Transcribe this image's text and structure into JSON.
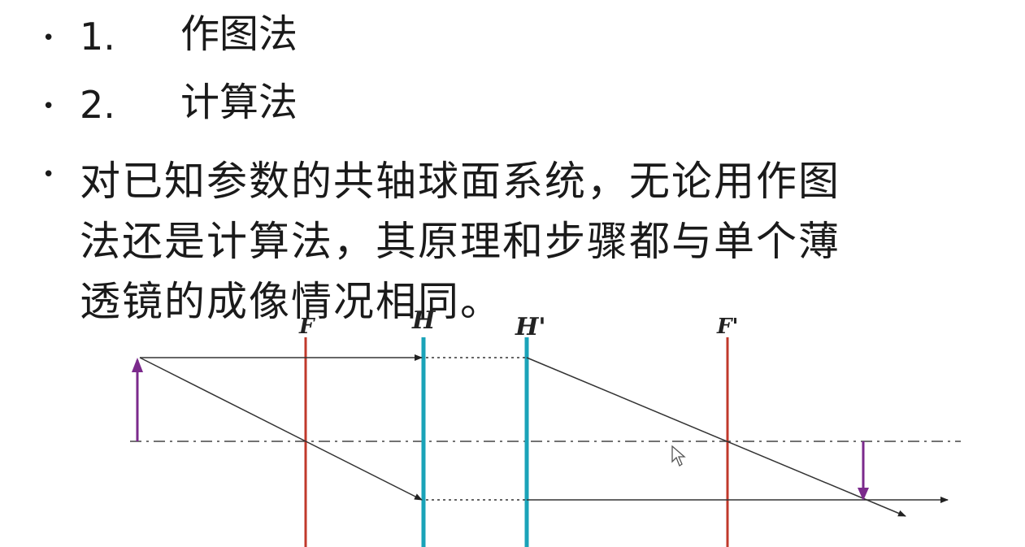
{
  "list": {
    "item1": {
      "number": "1.",
      "text": "作图法"
    },
    "item2": {
      "number": "2.",
      "text": "计算法"
    },
    "paragraph": {
      "line1": "对已知参数的共轴球面系统，无论用作图",
      "line2": "法还是计算法，其原理和步骤都与单个薄",
      "line3": "透镜的成像情况相同。"
    }
  },
  "diagram": {
    "labels": {
      "F": "F",
      "H": "H",
      "H_prime": "H'",
      "F_prime": "F'"
    },
    "colors": {
      "focal_plane": "#c0392b",
      "principal_plane": "#1aa3b8",
      "object_arrow": "#7b2a8c",
      "ray": "#333333",
      "axis": "#444444"
    }
  }
}
